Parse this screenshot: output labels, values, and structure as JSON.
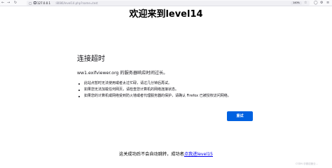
{
  "browser": {
    "url_host": "127.0.0.1",
    "url_path": ":8086/level14.php?name=test",
    "zoom": "140%",
    "icons": {
      "back": "arrow-left-icon",
      "forward": "arrow-right-icon",
      "reload": "reload-icon",
      "shield": "shield-icon",
      "lock": "lock-icon",
      "bookmark": "star-icon",
      "pocket": "pocket-icon",
      "extensions": "extensions-icon",
      "menu": "hamburger-menu-icon"
    }
  },
  "page": {
    "heading": "欢迎来到level14",
    "error": {
      "title": "连接超时",
      "description": "ww1.exifviewer.org 的服务器响应时间过长。",
      "suggestions": [
        "此站点暂时无法使用或者太过忙碌，请过几分钟后再试。",
        "如果您无法加载任何网页，请检查您计算机的网络连接状态。",
        "如果您的计算机或网络受到防火墙或者代理服务器的保护，请确认 Firefox 已被授权访问网络。"
      ],
      "retry_label": "重试"
    },
    "redirect_prefix": "这关成功后不会自动跳转，成功者",
    "next_level_link": "点我进level15"
  },
  "watermark": "CSDN @被迫营业..."
}
